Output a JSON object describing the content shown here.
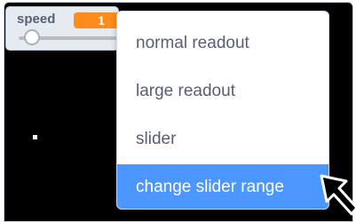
{
  "monitor": {
    "variable_name": "speed",
    "value": "1",
    "slider_value_fraction": 0.15
  },
  "context_menu": {
    "items": [
      {
        "label": "normal readout",
        "highlighted": false
      },
      {
        "label": "large readout",
        "highlighted": false
      },
      {
        "label": "slider",
        "highlighted": false
      },
      {
        "label": "change slider range",
        "highlighted": true
      }
    ]
  },
  "colors": {
    "value_badge": "#ff8c1a",
    "menu_highlight": "#4c97ff",
    "menu_text": "#575e75",
    "stage_background": "#000000"
  },
  "icons": {
    "cursor": "arrow-cursor-icon"
  }
}
